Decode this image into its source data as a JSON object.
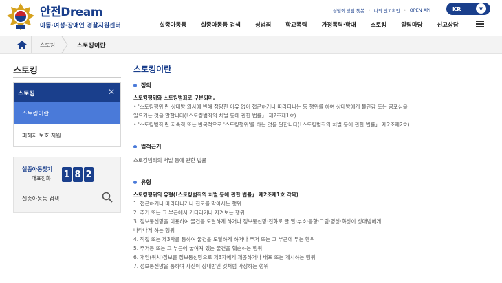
{
  "header": {
    "logo_title": "안전Dream",
    "logo_sub": "아동·여성·장애인 경찰지원센터",
    "util_links": [
      "성범죄 상담 챗봇",
      "나의 신고확인",
      "OPEN API"
    ],
    "lang": "KR",
    "nav": [
      "실종아동등",
      "실종아동등 검색",
      "성범죄",
      "학교폭력",
      "가정폭력·학대",
      "스토킹",
      "알림마당",
      "신고상담"
    ]
  },
  "breadcrumb": {
    "level1": "스토킹",
    "level2": "스토킹이란"
  },
  "sidebar": {
    "title": "스토킹",
    "menu_head": "스토킹",
    "items": [
      "스토킹이란",
      "피해자 보호·지원"
    ],
    "missing": {
      "title": "실종아동찾기",
      "sub": "대표전화",
      "digits": [
        "1",
        "8",
        "2"
      ],
      "search_label": "실종아동등 검색"
    }
  },
  "main": {
    "title": "스토킹이란",
    "sections": [
      {
        "heading": "정의",
        "lines": [
          "스토킹행위와 스토킹범죄로 구분되며,",
          "• '스토킹행위'란 상대방 의사에 반해 정당한 이유 없이 접근하거나 따라다니는 등 행위를 하여 상대방에게 불안감 또는 공포심을",
          "일으키는 것을 말합니다(「스토킹범죄의 처벌 등에 관한 법률」 제2조제1호)",
          "• '스토킹범죄'란 지속적 또는 반복적으로 '스토킹행위'를 하는 것을 말합니다(「스토킹범죄의 처벌 등에 관한 법률」 제2조제2호)"
        ]
      },
      {
        "heading": "법적근거",
        "lines": [
          "스토킹범죄의 처벌 등에 관한 법률"
        ]
      },
      {
        "heading": "유형",
        "lines": [
          "스토킹행위의 유형(「스토킹범죄의 처벌 등에 관한 법률」 제2조제1호 각목)",
          "1. 접근하거나 따라다니거나 진로를 막아서는 행위",
          "2. 주거 또는 그 부근에서 기다리거나 지켜보는 행위",
          "3. 정보통신망을 이용하여 물건을 도달하게 하거나 정보통신망·전화로 글·말·부호·음향·그림·영상·화상이 상대방에게",
          "나타나게 하는 행위",
          "4. 직접 또는 제3자를 통하여 물건을 도달하게 하거나 주거 또는 그 부근에 두는 행위",
          "5. 주거등 또는 그 부근에 놓여져 있는 물건을 훼손하는 행위",
          "6. 개인(위치)정보를 정보통신망으로 제3자에게 제공하거나 배포 또는 게시하는 행위",
          "7. 정보통신망을 통하여 자신이 상대방인 것처럼 가장하는 행위"
        ]
      }
    ]
  }
}
